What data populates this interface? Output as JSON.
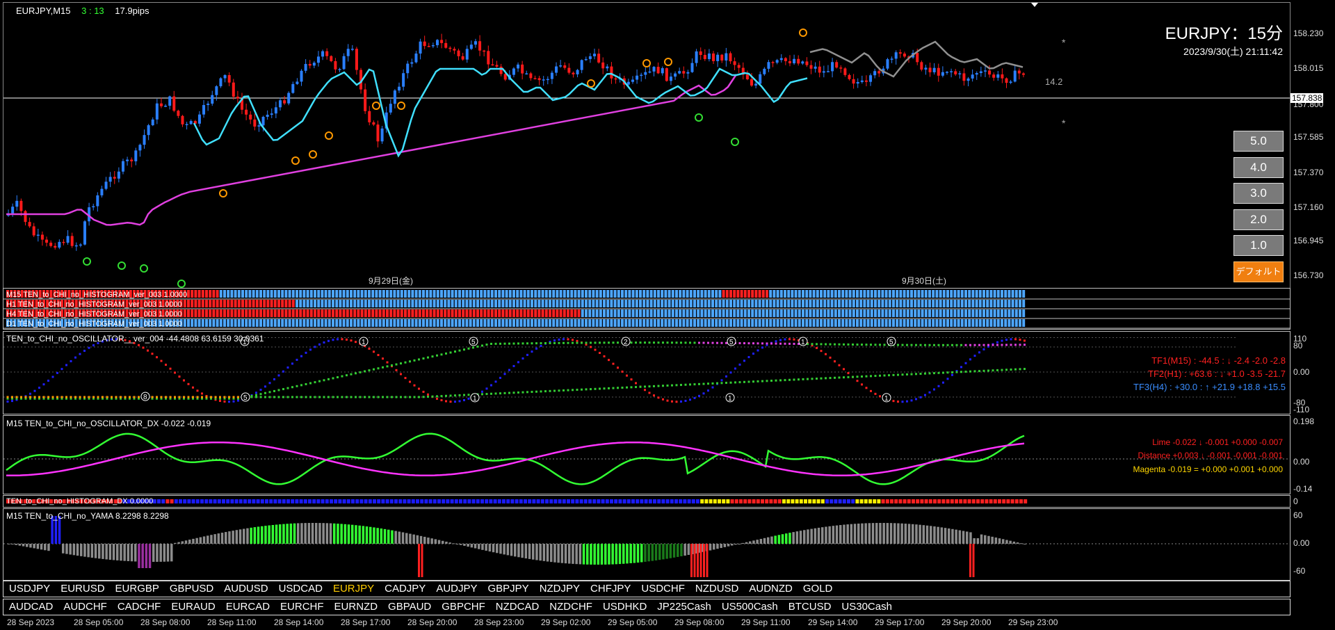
{
  "chart_header": {
    "symbol": "EURJPY,M15",
    "countdown": "3 : 13",
    "spread": "17.9pips"
  },
  "title_block": {
    "title": "EURJPY：15分",
    "datetime": "2023/9/30(土) 21:11:42"
  },
  "range_label": "14.2",
  "price_axis": [
    "158.230",
    "158.015",
    "157.800",
    "157.585",
    "157.370",
    "157.160",
    "156.945",
    "156.730"
  ],
  "current_price": "157.838",
  "date_separators": [
    "9月29日(金)",
    "9月30日(土)"
  ],
  "preset_buttons": [
    "5.0",
    "4.0",
    "3.0",
    "2.0",
    "1.0"
  ],
  "default_button": "デフォルト",
  "histogram_rows": [
    "M15 TEN_to_CHI_no_HISTOGRAM_ver_003 1.0000",
    "H1 TEN_to_CHI_no_HISTOGRAM_ver_003 1.0000",
    "H4 TEN_to_CHI_no_HISTOGRAM_ver_003 1.0000",
    "D1 TEN_to_CHI_no_HISTOGRAM_ver_003 1.0000"
  ],
  "oscillator": {
    "label": "TEN_to_CHI_no_OSCILLATOR__ver_004 -44.4808 63.6159 30.0361",
    "scale": [
      "110",
      "80",
      "0.00",
      "-80",
      "-110"
    ],
    "tf1": "TF1(M15) : -44.5 : ↓  -2.4  -2.0  -2.8",
    "tf2": "TF2(H1) : +63.6 : ↓  +1.0  -3.5  -21.7",
    "tf3": "TF3(H4) : +30.0 : ↑  +21.9  +18.8  +15.5",
    "colors": {
      "tf1": "#ff2020",
      "tf2": "#ff2020",
      "tf3": "#3a8dff"
    }
  },
  "dx": {
    "label": "M15 TEN_to_CHI_no_OSCILLATOR_DX  -0.022 -0.019",
    "scale": [
      "0.198",
      "0.00",
      "-0.14"
    ],
    "line1": "Lime -0.022 ↓  -0.001  +0.000  -0.007",
    "line2": "Distance +0.003 ↓  -0.001  -0.001  -0.001",
    "line3": "Magenta -0.019 = +0.000 +0.001 +0.000"
  },
  "histogram_dx": {
    "label": "TEN_to_CHI_no_HISTOGRAM_DX 0.0000",
    "scale": "0"
  },
  "yama": {
    "label": "M15  TEN_to_CHI_no_YAMA  8.2298 8.2298",
    "scale": [
      "60",
      "0.00",
      "-60"
    ]
  },
  "symbols_row1": [
    "USDJPY",
    "EURUSD",
    "EURGBP",
    "GBPUSD",
    "AUDUSD",
    "USDCAD",
    "EURJPY",
    "CADJPY",
    "AUDJPY",
    "GBPJPY",
    "NZDJPY",
    "CHFJPY",
    "USDCHF",
    "NZDUSD",
    "AUDNZD",
    "GOLD"
  ],
  "active_symbol": "EURJPY",
  "symbols_row2": [
    "AUDCAD",
    "AUDCHF",
    "CADCHF",
    "EURAUD",
    "EURCAD",
    "EURCHF",
    "EURNZD",
    "GBPAUD",
    "GBPCHF",
    "NZDCAD",
    "NZDCHF",
    "USDHKD",
    "JP225Cash",
    "US500Cash",
    "BTCUSD",
    "US30Cash"
  ],
  "time_axis": [
    "28 Sep 2023",
    "28 Sep 05:00",
    "28 Sep 08:00",
    "28 Sep 11:00",
    "28 Sep 14:00",
    "28 Sep 17:00",
    "28 Sep 20:00",
    "28 Sep 23:00",
    "29 Sep 02:00",
    "29 Sep 05:00",
    "29 Sep 08:00",
    "29 Sep 11:00",
    "29 Sep 14:00",
    "29 Sep 17:00",
    "29 Sep 20:00",
    "29 Sep 23:00"
  ],
  "colors": {
    "bull": "#2a7fff",
    "bear": "#ff1a1a",
    "ma_fast": "#40e0ff",
    "ma_slow": "#e040e0",
    "ma_grey": "#909090",
    "lime": "#33ff33",
    "magenta": "#ff33ff",
    "active_symbol": "#ffcc00"
  }
}
